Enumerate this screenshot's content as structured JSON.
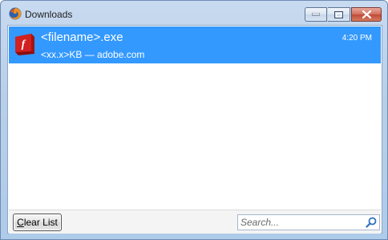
{
  "window": {
    "title": "Downloads"
  },
  "downloads": [
    {
      "filename": "<filename>.exe",
      "status": "<xx.x>KB — adobe.com",
      "time": "4:20 PM",
      "icon": "flash-installer-icon"
    }
  ],
  "bottom": {
    "clear_first": "C",
    "clear_rest": "lear List",
    "search_placeholder": "Search..."
  },
  "colors": {
    "selection": "#3399ff",
    "titlebar": "#b9cfe9",
    "close_button": "#c24a38"
  }
}
